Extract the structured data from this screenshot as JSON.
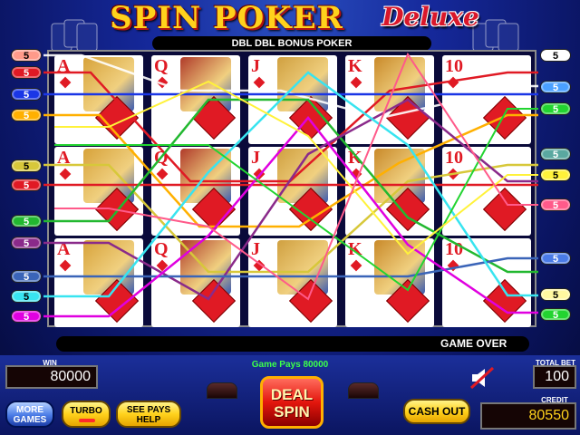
{
  "header": {
    "title_main": "SPIN POKER",
    "title_sub": "Deluxe",
    "game_name": "DBL DBL BONUS POKER"
  },
  "cards": [
    [
      {
        "rank": "A",
        "face": "ace"
      },
      {
        "rank": "Q",
        "face": "queen"
      },
      {
        "rank": "J",
        "face": "jack"
      },
      {
        "rank": "K",
        "face": "king"
      },
      {
        "rank": "10",
        "face": "none"
      }
    ],
    [
      {
        "rank": "A",
        "face": "ace"
      },
      {
        "rank": "Q",
        "face": "queen"
      },
      {
        "rank": "J",
        "face": "jack"
      },
      {
        "rank": "K",
        "face": "king"
      },
      {
        "rank": "10",
        "face": "none"
      }
    ],
    [
      {
        "rank": "A",
        "face": "ace"
      },
      {
        "rank": "Q",
        "face": "queen"
      },
      {
        "rank": "J",
        "face": "jack"
      },
      {
        "rank": "K",
        "face": "king"
      },
      {
        "rank": "10",
        "face": "none"
      }
    ]
  ],
  "suit": "diamonds",
  "paylines_left": [
    {
      "value": "5",
      "color": "#ff9a8a"
    },
    {
      "value": "5",
      "color": "#e01a24"
    },
    {
      "value": "5",
      "color": "#1a36e6"
    },
    {
      "value": "5",
      "color": "#ffb000"
    },
    {
      "value": "5",
      "color": "#d7c83a"
    },
    {
      "value": "5",
      "color": "#e01a24"
    },
    {
      "value": "5",
      "color": "#22b830"
    },
    {
      "value": "5",
      "color": "#8a2a8a"
    },
    {
      "value": "5",
      "color": "#3a64b8"
    },
    {
      "value": "5",
      "color": "#38e4f0"
    },
    {
      "value": "5",
      "color": "#e000e0"
    }
  ],
  "paylines_right": [
    {
      "value": "5",
      "color": "#ffffff"
    },
    {
      "value": "5",
      "color": "#4aa0ff"
    },
    {
      "value": "5",
      "color": "#22d430"
    },
    {
      "value": "5",
      "color": "#5aa8a0"
    },
    {
      "value": "5",
      "color": "#fff23a"
    },
    {
      "value": "5",
      "color": "#ff5a8a"
    },
    {
      "value": "5",
      "color": "#4a7be6"
    },
    {
      "value": "5",
      "color": "#fff8a0"
    },
    {
      "value": "5",
      "color": "#22d430"
    }
  ],
  "status": {
    "message": "GAME OVER",
    "pays_text": "Game Pays 80000"
  },
  "meters": {
    "win_label": "WIN",
    "win_value": "80000",
    "total_bet_label": "TOTAL BET",
    "total_bet_value": "100",
    "credit_label": "CREDIT",
    "credit_value": "80550"
  },
  "buttons": {
    "more_games": "MORE GAMES",
    "turbo": "TURBO",
    "see_pays": "SEE PAYS HELP",
    "deal_spin": "DEAL SPIN",
    "cash_out": "CASH OUT"
  },
  "icons": {
    "mute": "speaker-muted-icon"
  },
  "colors": {
    "card_red": "#e01a24",
    "title_gold": "#ffd21c",
    "win_green": "#3cff4a"
  }
}
